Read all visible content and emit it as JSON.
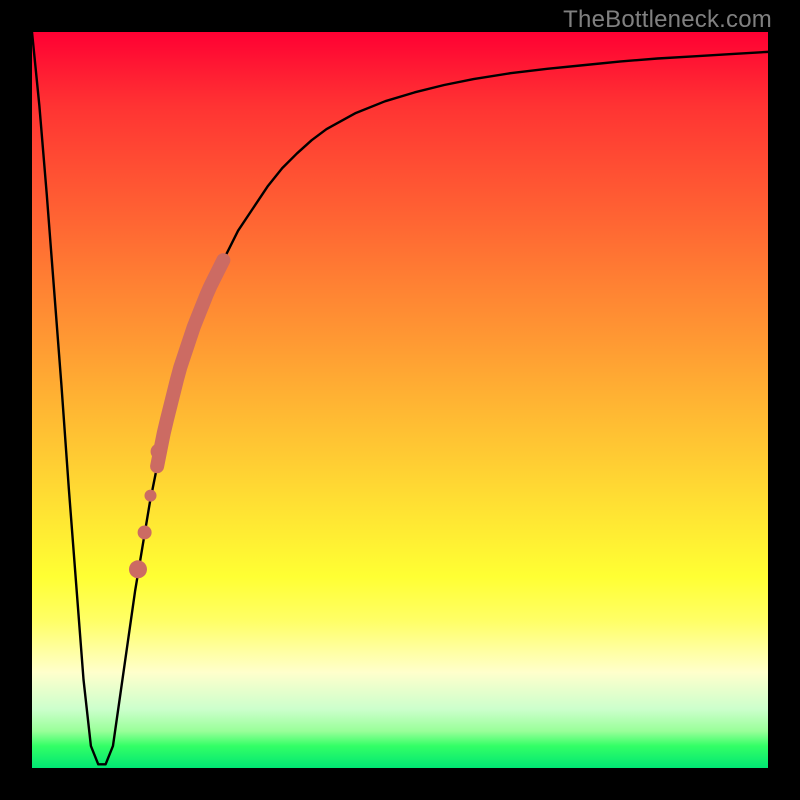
{
  "watermark": "TheBottleneck.com",
  "colors": {
    "frame": "#000000",
    "curve": "#000000",
    "highlight": "#cc6b63",
    "gradient_top": "#ff0033",
    "gradient_bottom": "#00e673",
    "watermark": "#808080"
  },
  "chart_data": {
    "type": "line",
    "title": "",
    "xlabel": "",
    "ylabel": "",
    "xlim": [
      0,
      100
    ],
    "ylim": [
      0,
      100
    ],
    "grid": false,
    "x": [
      0,
      1,
      2,
      3,
      4,
      5,
      6,
      7,
      8,
      9,
      10,
      11,
      12,
      13,
      14,
      15,
      16,
      17,
      18,
      19,
      20,
      22,
      24,
      26,
      28,
      30,
      32,
      34,
      36,
      38,
      40,
      44,
      48,
      52,
      56,
      60,
      65,
      70,
      75,
      80,
      85,
      90,
      95,
      100
    ],
    "y": [
      100,
      90,
      78,
      65,
      52,
      38,
      25,
      12,
      3,
      0.5,
      0.5,
      3,
      10,
      17,
      24,
      30,
      36,
      41,
      46,
      50,
      54,
      60,
      65,
      69,
      73,
      76,
      79,
      81.5,
      83.5,
      85.3,
      86.8,
      89,
      90.6,
      91.8,
      92.8,
      93.6,
      94.4,
      95,
      95.5,
      96,
      96.4,
      96.7,
      97,
      97.3
    ],
    "annotations": {
      "highlight_segment": {
        "x_start": 17,
        "x_end": 26,
        "style": "thick"
      },
      "highlight_dots": [
        {
          "x": 17.2,
          "y": 43
        },
        {
          "x": 16.1,
          "y": 37
        },
        {
          "x": 15.3,
          "y": 32
        },
        {
          "x": 14.4,
          "y": 27
        }
      ]
    }
  }
}
